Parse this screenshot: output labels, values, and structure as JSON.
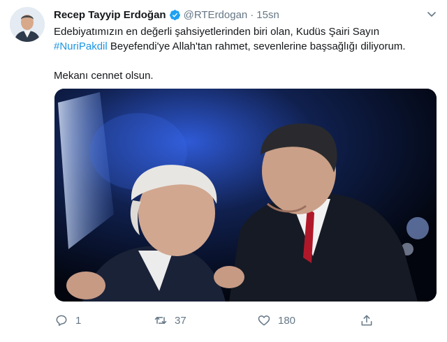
{
  "author": {
    "name": "Recep Tayyip Erdoğan",
    "handle": "@RTErdogan",
    "separator": "·",
    "time": "15sn",
    "verified": true
  },
  "tweet": {
    "line1": "Edebiyatımızın en değerli şahsiyetlerinden biri olan, Kudüs Şairi Sayın",
    "hashtag": "#NuriPakdil",
    "line2_rest": " Beyefendi'ye Allah'tan rahmet, sevenlerine başsağlığı diliyorum.",
    "line3": "Mekanı cennet olsun."
  },
  "actions": {
    "reply_count": "1",
    "retweet_count": "37",
    "like_count": "180"
  },
  "colors": {
    "link": "#1b95e0",
    "muted": "#657786",
    "verified": "#1da1f2"
  }
}
